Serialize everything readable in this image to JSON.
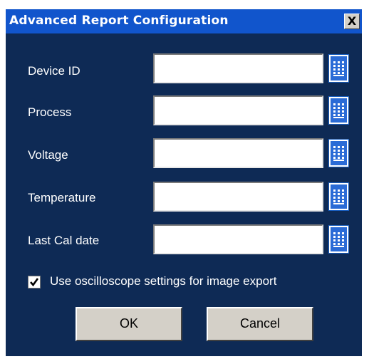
{
  "window": {
    "title": "Advanced Report Configuration",
    "close_label": "X"
  },
  "fields": [
    {
      "label": "Device ID",
      "value": ""
    },
    {
      "label": "Process",
      "value": ""
    },
    {
      "label": "Voltage",
      "value": ""
    },
    {
      "label": "Temperature",
      "value": ""
    },
    {
      "label": "Last Cal date",
      "value": ""
    }
  ],
  "checkbox": {
    "label": "Use oscilloscope settings for image export",
    "checked": true
  },
  "buttons": {
    "ok": "OK",
    "cancel": "Cancel"
  },
  "colors": {
    "title_bar": "#1155cc",
    "background": "#0e2a55",
    "keypad_button": "#2a6bd6"
  },
  "icons": {
    "field_button": "keypad-grid-icon"
  }
}
